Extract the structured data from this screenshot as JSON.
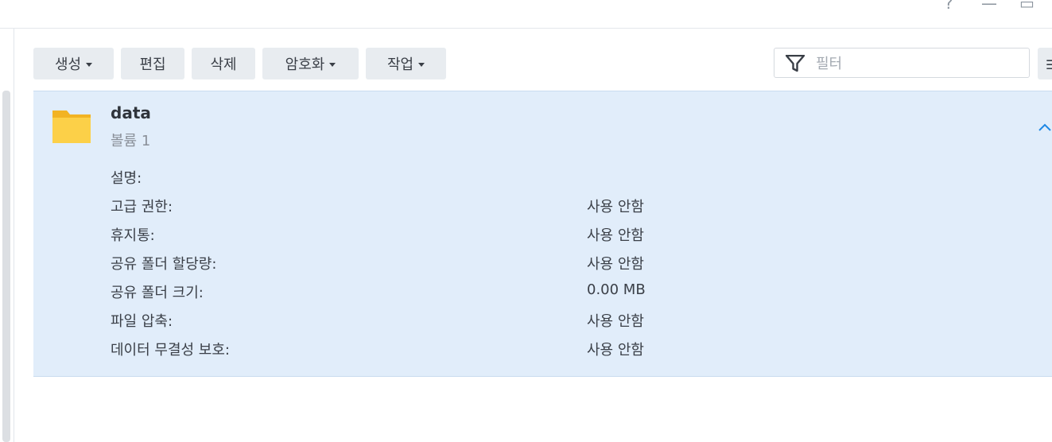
{
  "window": {
    "help_glyph": "?",
    "minimize_glyph": "—",
    "maximize_glyph": "▭"
  },
  "toolbar": {
    "create": "생성",
    "edit": "편집",
    "delete": "삭제",
    "encrypt": "암호화",
    "action": "작업"
  },
  "filter": {
    "placeholder": "필터"
  },
  "folder": {
    "name": "data",
    "volume": "볼륨 1",
    "details": [
      {
        "label": "설명:",
        "value": ""
      },
      {
        "label": "고급 권한:",
        "value": "사용 안함"
      },
      {
        "label": "휴지통:",
        "value": "사용 안함"
      },
      {
        "label": "공유 폴더 할당량:",
        "value": "사용 안함"
      },
      {
        "label": "공유 폴더 크기:",
        "value": "0.00 MB"
      },
      {
        "label": "파일 압축:",
        "value": "사용 안함"
      },
      {
        "label": "데이터 무결성 보호:",
        "value": "사용 안함"
      }
    ]
  },
  "colors": {
    "panel_bg": "#e1edfa",
    "accent": "#1e88e5",
    "folder": "#f9c433"
  }
}
